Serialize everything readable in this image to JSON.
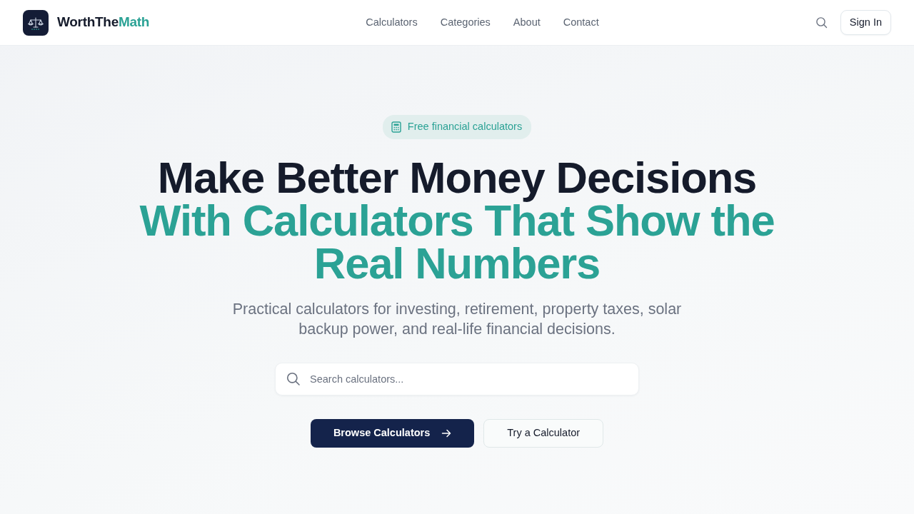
{
  "header": {
    "brand": {
      "name": "WorthThe",
      "accent": "Math"
    },
    "nav": [
      "Calculators",
      "Categories",
      "About",
      "Contact"
    ],
    "sign_in": "Sign In"
  },
  "hero": {
    "badge": "Free financial calculators",
    "heading": {
      "main": "Make Better Money Decisions",
      "highlight": "With Calculators That Show the Real Numbers"
    },
    "subtitle": "Practical calculators for investing, retirement, property taxes, solar backup power, and real-life financial decisions.",
    "search": {
      "placeholder": "Search calculators..."
    },
    "buttons": [
      {
        "label": "Browse Calculators",
        "kind": "primary"
      },
      {
        "label": "Try a Calculator",
        "kind": "secondary"
      }
    ]
  }
}
